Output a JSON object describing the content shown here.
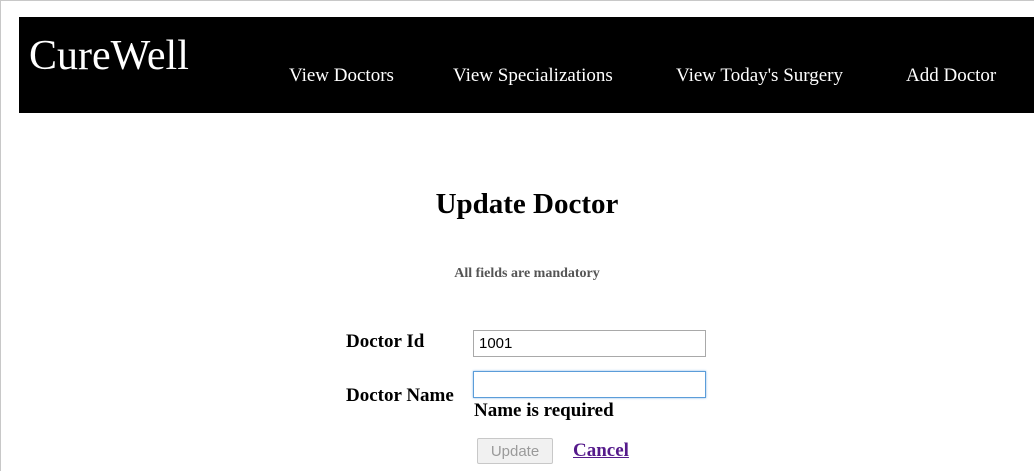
{
  "navbar": {
    "brand": "CureWell",
    "links": [
      {
        "label": "View Doctors"
      },
      {
        "label": "View Specializations"
      },
      {
        "label": "View Today's Surgery"
      },
      {
        "label": "Add Doctor"
      }
    ]
  },
  "form": {
    "title": "Update Doctor",
    "subtitle": "All fields are mandatory",
    "doctor_id": {
      "label": "Doctor Id",
      "value": "1001"
    },
    "doctor_name": {
      "label": "Doctor Name",
      "value": "",
      "error": "Name is required"
    },
    "update_label": "Update",
    "cancel_label": "Cancel"
  },
  "colors": {
    "navbar_bg": "#000000",
    "nav_text": "#ffffff",
    "cancel_link": "#551a8b",
    "focus_border": "#5b9dd9"
  }
}
